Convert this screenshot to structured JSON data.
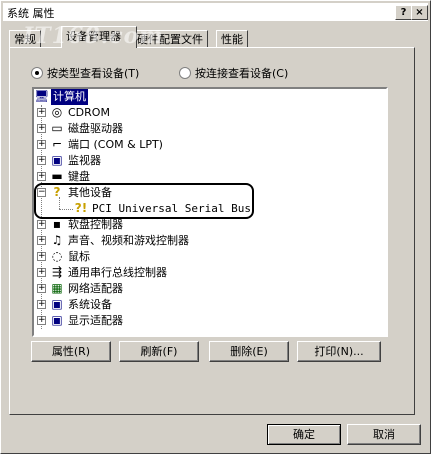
{
  "window": {
    "title": "系统 属性",
    "help_button": "?",
    "close_button": "×"
  },
  "watermark": "IT168.com",
  "tabs": [
    {
      "label": "常规"
    },
    {
      "label": "设备管理器"
    },
    {
      "label": "硬件配置文件"
    },
    {
      "label": "性能"
    }
  ],
  "view_mode": {
    "by_type": "按类型查看设备(T)",
    "by_connection": "按连接查看设备(C)",
    "selected": "by_type"
  },
  "tree": {
    "root": "计算机",
    "items": [
      {
        "label": "CDROM",
        "icon": "cdrom-icon"
      },
      {
        "label": "磁盘驱动器",
        "icon": "disk-icon"
      },
      {
        "label": "端口 (COM & LPT)",
        "icon": "port-icon"
      },
      {
        "label": "监视器",
        "icon": "monitor-icon"
      },
      {
        "label": "键盘",
        "icon": "keyboard-icon"
      },
      {
        "label": "其他设备",
        "icon": "unknown-device-icon",
        "expanded": true
      },
      {
        "label": "PCI Universal Serial Bus",
        "icon": "warning-device-icon",
        "child": true
      },
      {
        "label": "软盘控制器",
        "icon": "floppy-icon"
      },
      {
        "label": "声音、视频和游戏控制器",
        "icon": "sound-icon"
      },
      {
        "label": "鼠标",
        "icon": "mouse-icon"
      },
      {
        "label": "通用串行总线控制器",
        "icon": "usb-icon"
      },
      {
        "label": "网络适配器",
        "icon": "network-icon"
      },
      {
        "label": "系统设备",
        "icon": "system-icon"
      },
      {
        "label": "显示适配器",
        "icon": "display-icon"
      }
    ]
  },
  "buttons": {
    "properties": "属性(R)",
    "refresh": "刷新(F)",
    "remove": "删除(E)",
    "print": "打印(N)...",
    "ok": "确定",
    "cancel": "取消"
  }
}
